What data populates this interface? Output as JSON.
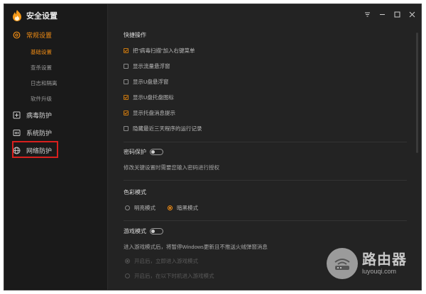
{
  "app": {
    "title": "安全设置"
  },
  "sidebar": {
    "groups": [
      {
        "label": "常规设置",
        "icon": "settings-icon"
      },
      {
        "label": "病毒防护",
        "icon": "plus-square-icon"
      },
      {
        "label": "系统防护",
        "icon": "system-shield-icon"
      },
      {
        "label": "网络防护",
        "icon": "globe-icon"
      }
    ],
    "sub_items": [
      "基础设置",
      "查杀设置",
      "日志和隔离",
      "软件升级"
    ]
  },
  "main": {
    "quick_ops": {
      "title": "快捷操作",
      "options": [
        {
          "label": "把“病毒扫描”加入右键菜单",
          "checked": true
        },
        {
          "label": "显示流量悬浮窗",
          "checked": false
        },
        {
          "label": "显示U盘悬浮窗",
          "checked": false
        },
        {
          "label": "显示U盘托盘图标",
          "checked": true
        },
        {
          "label": "显示托盘消息提示",
          "checked": true
        },
        {
          "label": "隐藏最近三天程序的运行记录",
          "checked": false
        }
      ]
    },
    "password": {
      "title": "密码保护",
      "desc": "修改关键设置时需要您输入密码进行授权",
      "enabled": false
    },
    "color_mode": {
      "title": "色彩模式",
      "options": [
        {
          "label": "明亮模式",
          "selected": false
        },
        {
          "label": "暗黑模式",
          "selected": true
        }
      ]
    },
    "game_mode": {
      "title": "游戏模式",
      "desc": "进入游戏模式后，将暂停Windows更新且不推送火绒弹窗消息",
      "enabled": false,
      "options": [
        {
          "label": "开启后，立即进入游戏模式",
          "selected": true
        },
        {
          "label": "开启后，在以下时机进入游戏模式",
          "selected": false
        }
      ]
    }
  },
  "watermark": {
    "brand": "路由器",
    "domain": "luyouqi.com"
  },
  "colors": {
    "accent": "#f08c14",
    "highlight": "#d9201e",
    "bg": "#232323",
    "sidebar_bg": "#1a1a1a"
  }
}
